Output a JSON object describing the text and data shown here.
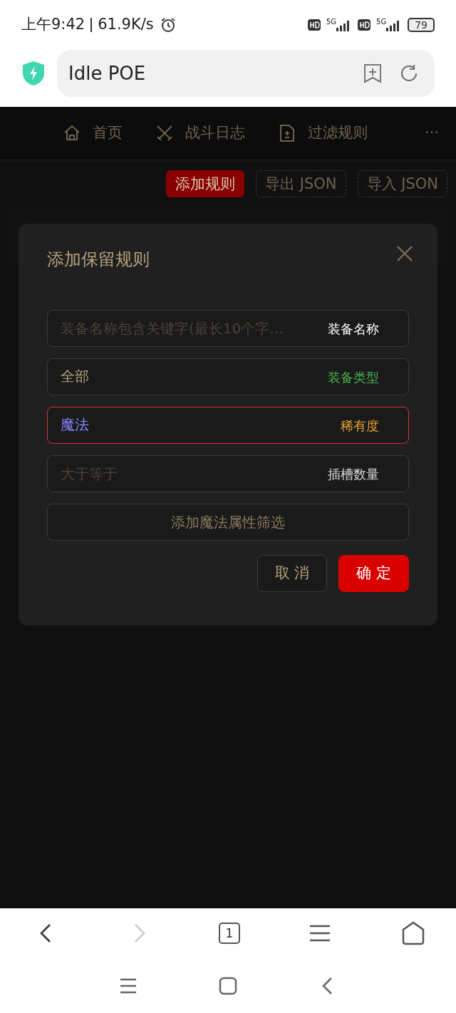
{
  "status_bar": {
    "time": "上午9:42",
    "speed": "61.9K/s",
    "network": [
      "5G",
      "5G"
    ],
    "battery": "79"
  },
  "address_bar": {
    "title": "Idle POE"
  },
  "nav": [
    {
      "label": "首页"
    },
    {
      "label": "战斗日志"
    },
    {
      "label": "过滤规则"
    }
  ],
  "nav_more": "···",
  "toolbar": [
    {
      "label": "添加规则",
      "kind": "primary"
    },
    {
      "label": "导出 JSON",
      "kind": "dashed"
    },
    {
      "label": "导入 JSON",
      "kind": "dashed"
    }
  ],
  "dialog": {
    "title": "添加保留规则",
    "fields": [
      {
        "placeholder": "装备名称包含关键字(最长10个字…",
        "suffix": {
          "text": "装备名称",
          "color": "#ffffff"
        },
        "focused": false
      },
      {
        "value": {
          "text": "全部",
          "color": "#b8a07a"
        },
        "suffix": {
          "text": "装备类型",
          "color": "#4caf50"
        },
        "focused": false
      },
      {
        "value": {
          "text": "魔法",
          "color": "#8888ff"
        },
        "suffix": {
          "text": "稀有度",
          "color": "#e8a030"
        },
        "focused": true
      },
      {
        "placeholder": "大于等于",
        "suffix": {
          "text": "插槽数量",
          "color": "#d8d8d8"
        },
        "focused": false
      }
    ],
    "add_button": "添加魔法属性筛选",
    "buttons": [
      {
        "label": "取 消",
        "kind": "default"
      },
      {
        "label": "确 定",
        "kind": "primary"
      }
    ]
  },
  "browser_nav": {
    "tab_count": "1"
  }
}
